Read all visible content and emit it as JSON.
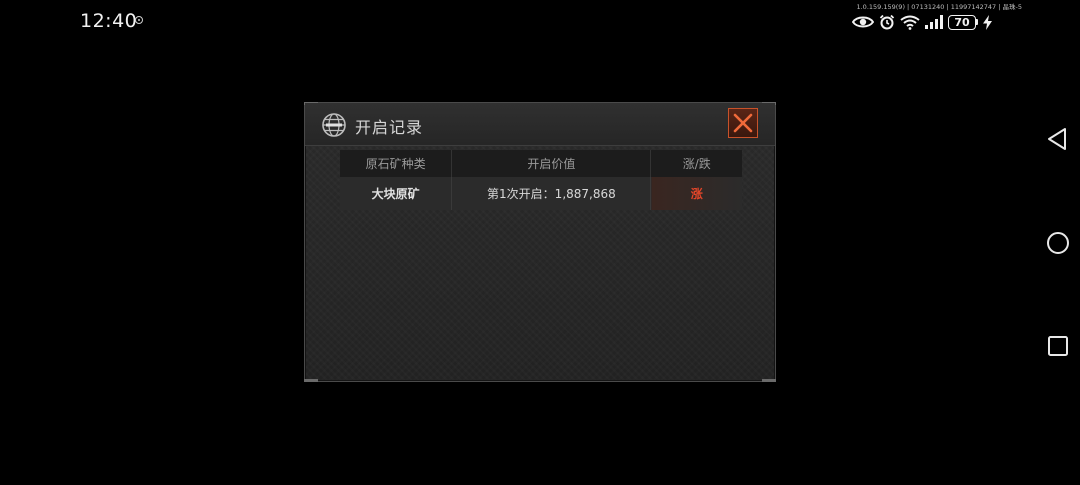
{
  "status_bar": {
    "time": "12:40",
    "build_info": "1.0.159.159(9) | 07131240 | 11997142747 | 晶珠-5",
    "battery_level": "70",
    "icons": [
      "eye-icon",
      "alarm-icon",
      "wifi-icon",
      "signal-icon",
      "battery-icon",
      "charging-icon"
    ]
  },
  "dialog": {
    "title": "开启记录",
    "close_label": "close",
    "columns": {
      "kind": "原石矿种类",
      "value": "开启价值",
      "change": "涨/跌"
    },
    "rows": [
      {
        "kind": "大块原矿",
        "value": "第1次开启：1,887,868",
        "change": "涨"
      }
    ],
    "colors": {
      "accent": "#c8522a",
      "rise": "#e2462a"
    }
  },
  "nav_bar": {
    "buttons": [
      "back-icon",
      "home-icon",
      "recent-apps-icon"
    ]
  }
}
